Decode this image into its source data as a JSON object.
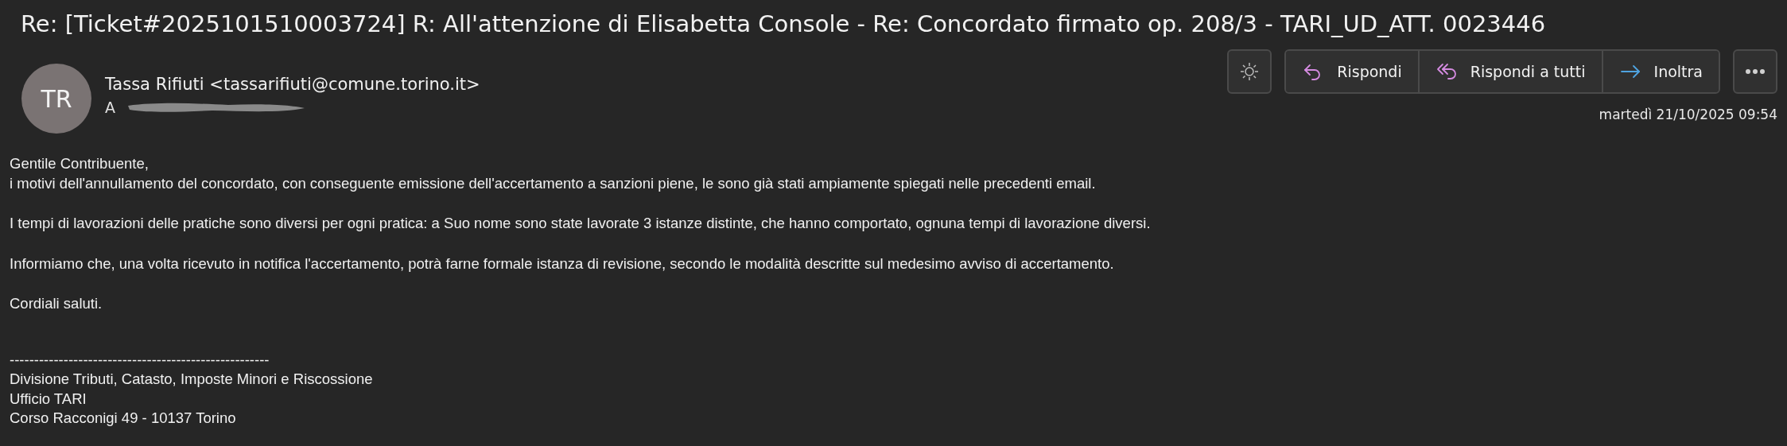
{
  "subject": "Re: [Ticket#2025101510003724] R: All'attenzione di Elisabetta Console - Re: Concordato firmato op. 208/3 - TARI_UD_ATT. 0023446",
  "sender": {
    "initials": "TR",
    "name": "Tassa Rifiuti <tassarifiuti@comune.torino.it>",
    "to_label": "A"
  },
  "actions": [
    {
      "kind": "reply",
      "label": "Rispondi"
    },
    {
      "kind": "reply_all",
      "label": "Rispondi a tutti"
    },
    {
      "kind": "forward",
      "label": "Inoltra"
    }
  ],
  "date": "martedì 21/10/2025 09:54",
  "body": [
    [
      "Gentile Contribuente,",
      "i motivi dell'annullamento del concordato, con conseguente emissione dell'accertamento a sanzioni piene, le sono già stati ampiamente spiegati nelle precedenti email."
    ],
    [
      "I tempi di lavorazioni delle pratiche sono diversi per ogni pratica: a Suo nome sono state lavorate 3 istanze distinte, che hanno comportato, ognuna tempi di lavorazione diversi."
    ],
    [
      "Informiamo che, una volta ricevuto in notifica l'accertamento, potrà farne formale istanza di revisione, secondo le modalità descritte sul medesimo avviso di accertamento."
    ],
    [
      "Cordiali saluti."
    ]
  ],
  "signature": [
    "-----------------------------------------------------",
    "Divisione Tributi, Catasto, Imposte Minori e Riscossione",
    "Ufficio TARI",
    "Corso Racconigi 49 - 10137 Torino"
  ]
}
